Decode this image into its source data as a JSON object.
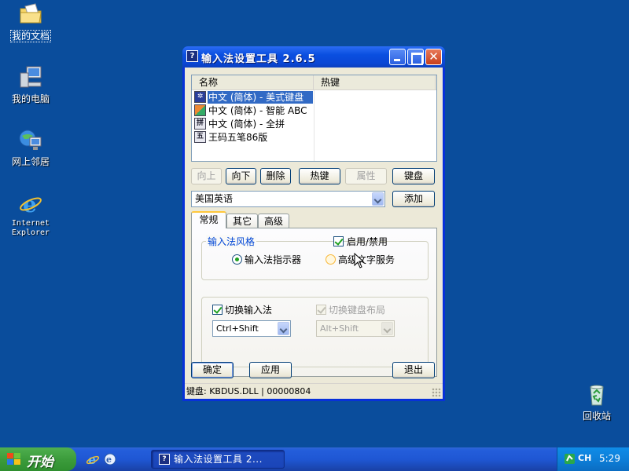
{
  "desktop": {
    "icons": [
      {
        "label": "我的文档",
        "icon": "my-documents-folder"
      },
      {
        "label": "我的电脑",
        "icon": "my-computer"
      },
      {
        "label": "网上邻居",
        "icon": "network-places"
      },
      {
        "label": "Internet Explorer",
        "icon": "internet-explorer"
      },
      {
        "label": "回收站",
        "icon": "recycle-bin"
      }
    ]
  },
  "window": {
    "title": "输入法设置工具 2.6.5",
    "close_glyph": "✕",
    "list": {
      "columns": [
        "名称",
        "热键"
      ],
      "rows": [
        {
          "name": "中文 (简体) - 美式键盘",
          "hotkey": "",
          "icon_text": "",
          "selected": true
        },
        {
          "name": "中文 (简体) - 智能 ABC",
          "hotkey": "",
          "icon_text": "",
          "selected": false
        },
        {
          "name": "中文 (简体) - 全拼",
          "hotkey": "",
          "icon_text": "拼",
          "selected": false
        },
        {
          "name": "王码五笔86版",
          "hotkey": "",
          "icon_text": "五",
          "selected": false
        }
      ]
    },
    "buttons": {
      "up": "向上",
      "down": "向下",
      "delete": "删除",
      "hotkey": "热键",
      "properties": "属性",
      "keyboard": "键盘",
      "add": "添加",
      "ok": "确定",
      "apply": "应用",
      "exit": "退出"
    },
    "language_select": {
      "value": "美国英语"
    },
    "tabs": [
      "常规",
      "其它",
      "高级"
    ],
    "active_tab": "常规",
    "style_group": {
      "title": "输入法风格",
      "enable_label": "启用/禁用",
      "enable_checked": true,
      "radio_indicator": "输入法指示器",
      "radio_advanced": "高级文字服务",
      "selected": "输入法指示器"
    },
    "switch_group": {
      "switch_ime_label": "切换输入法",
      "switch_ime_checked": true,
      "switch_ime_combo": "Ctrl+Shift",
      "switch_kbd_label": "切换键盘布局",
      "switch_kbd_checked": true,
      "switch_kbd_combo": "Alt+Shift"
    },
    "status": "键盘: KBDUS.DLL | 00000804"
  },
  "taskbar": {
    "start_label": "开始",
    "task_title": "输入法设置工具 2...",
    "tray_lang": "CH",
    "clock": "5:29"
  },
  "colors": {
    "desktop": "#0a4d9c",
    "title_blue": "#0a46d5",
    "selection": "#316ac5",
    "start_green": "#3c9c3c"
  }
}
